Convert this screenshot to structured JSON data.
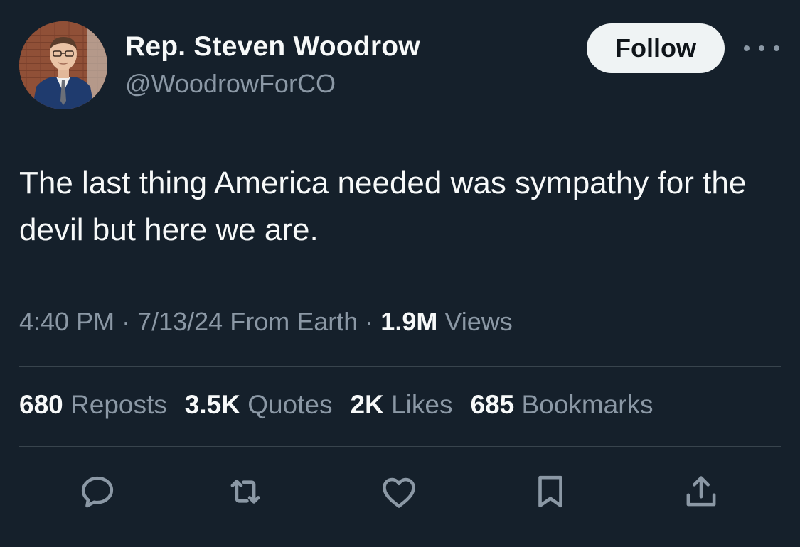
{
  "author": {
    "name": "Rep. Steven Woodrow",
    "handle": "@WoodrowForCO"
  },
  "follow_label": "Follow",
  "tweet": {
    "text": "The last thing America needed was sympathy for the devil but here we are.",
    "time": "4:40 PM",
    "date": "7/13/24",
    "source": "From Earth",
    "views_count": "1.9M",
    "views_label": "Views"
  },
  "stats": [
    {
      "count": "680",
      "label": "Reposts"
    },
    {
      "count": "3.5K",
      "label": "Quotes"
    },
    {
      "count": "2K",
      "label": "Likes"
    },
    {
      "count": "685",
      "label": "Bookmarks"
    }
  ],
  "icons": {
    "more": "more-icon",
    "reply": "reply-icon",
    "repost": "repost-icon",
    "like": "heart-icon",
    "bookmark": "bookmark-icon",
    "share": "share-icon"
  },
  "colors": {
    "background": "#15202b",
    "primary_text": "#f7f9f9",
    "secondary_text": "#8b98a5",
    "divider": "#38444d",
    "follow_button_bg": "#eff3f4"
  }
}
